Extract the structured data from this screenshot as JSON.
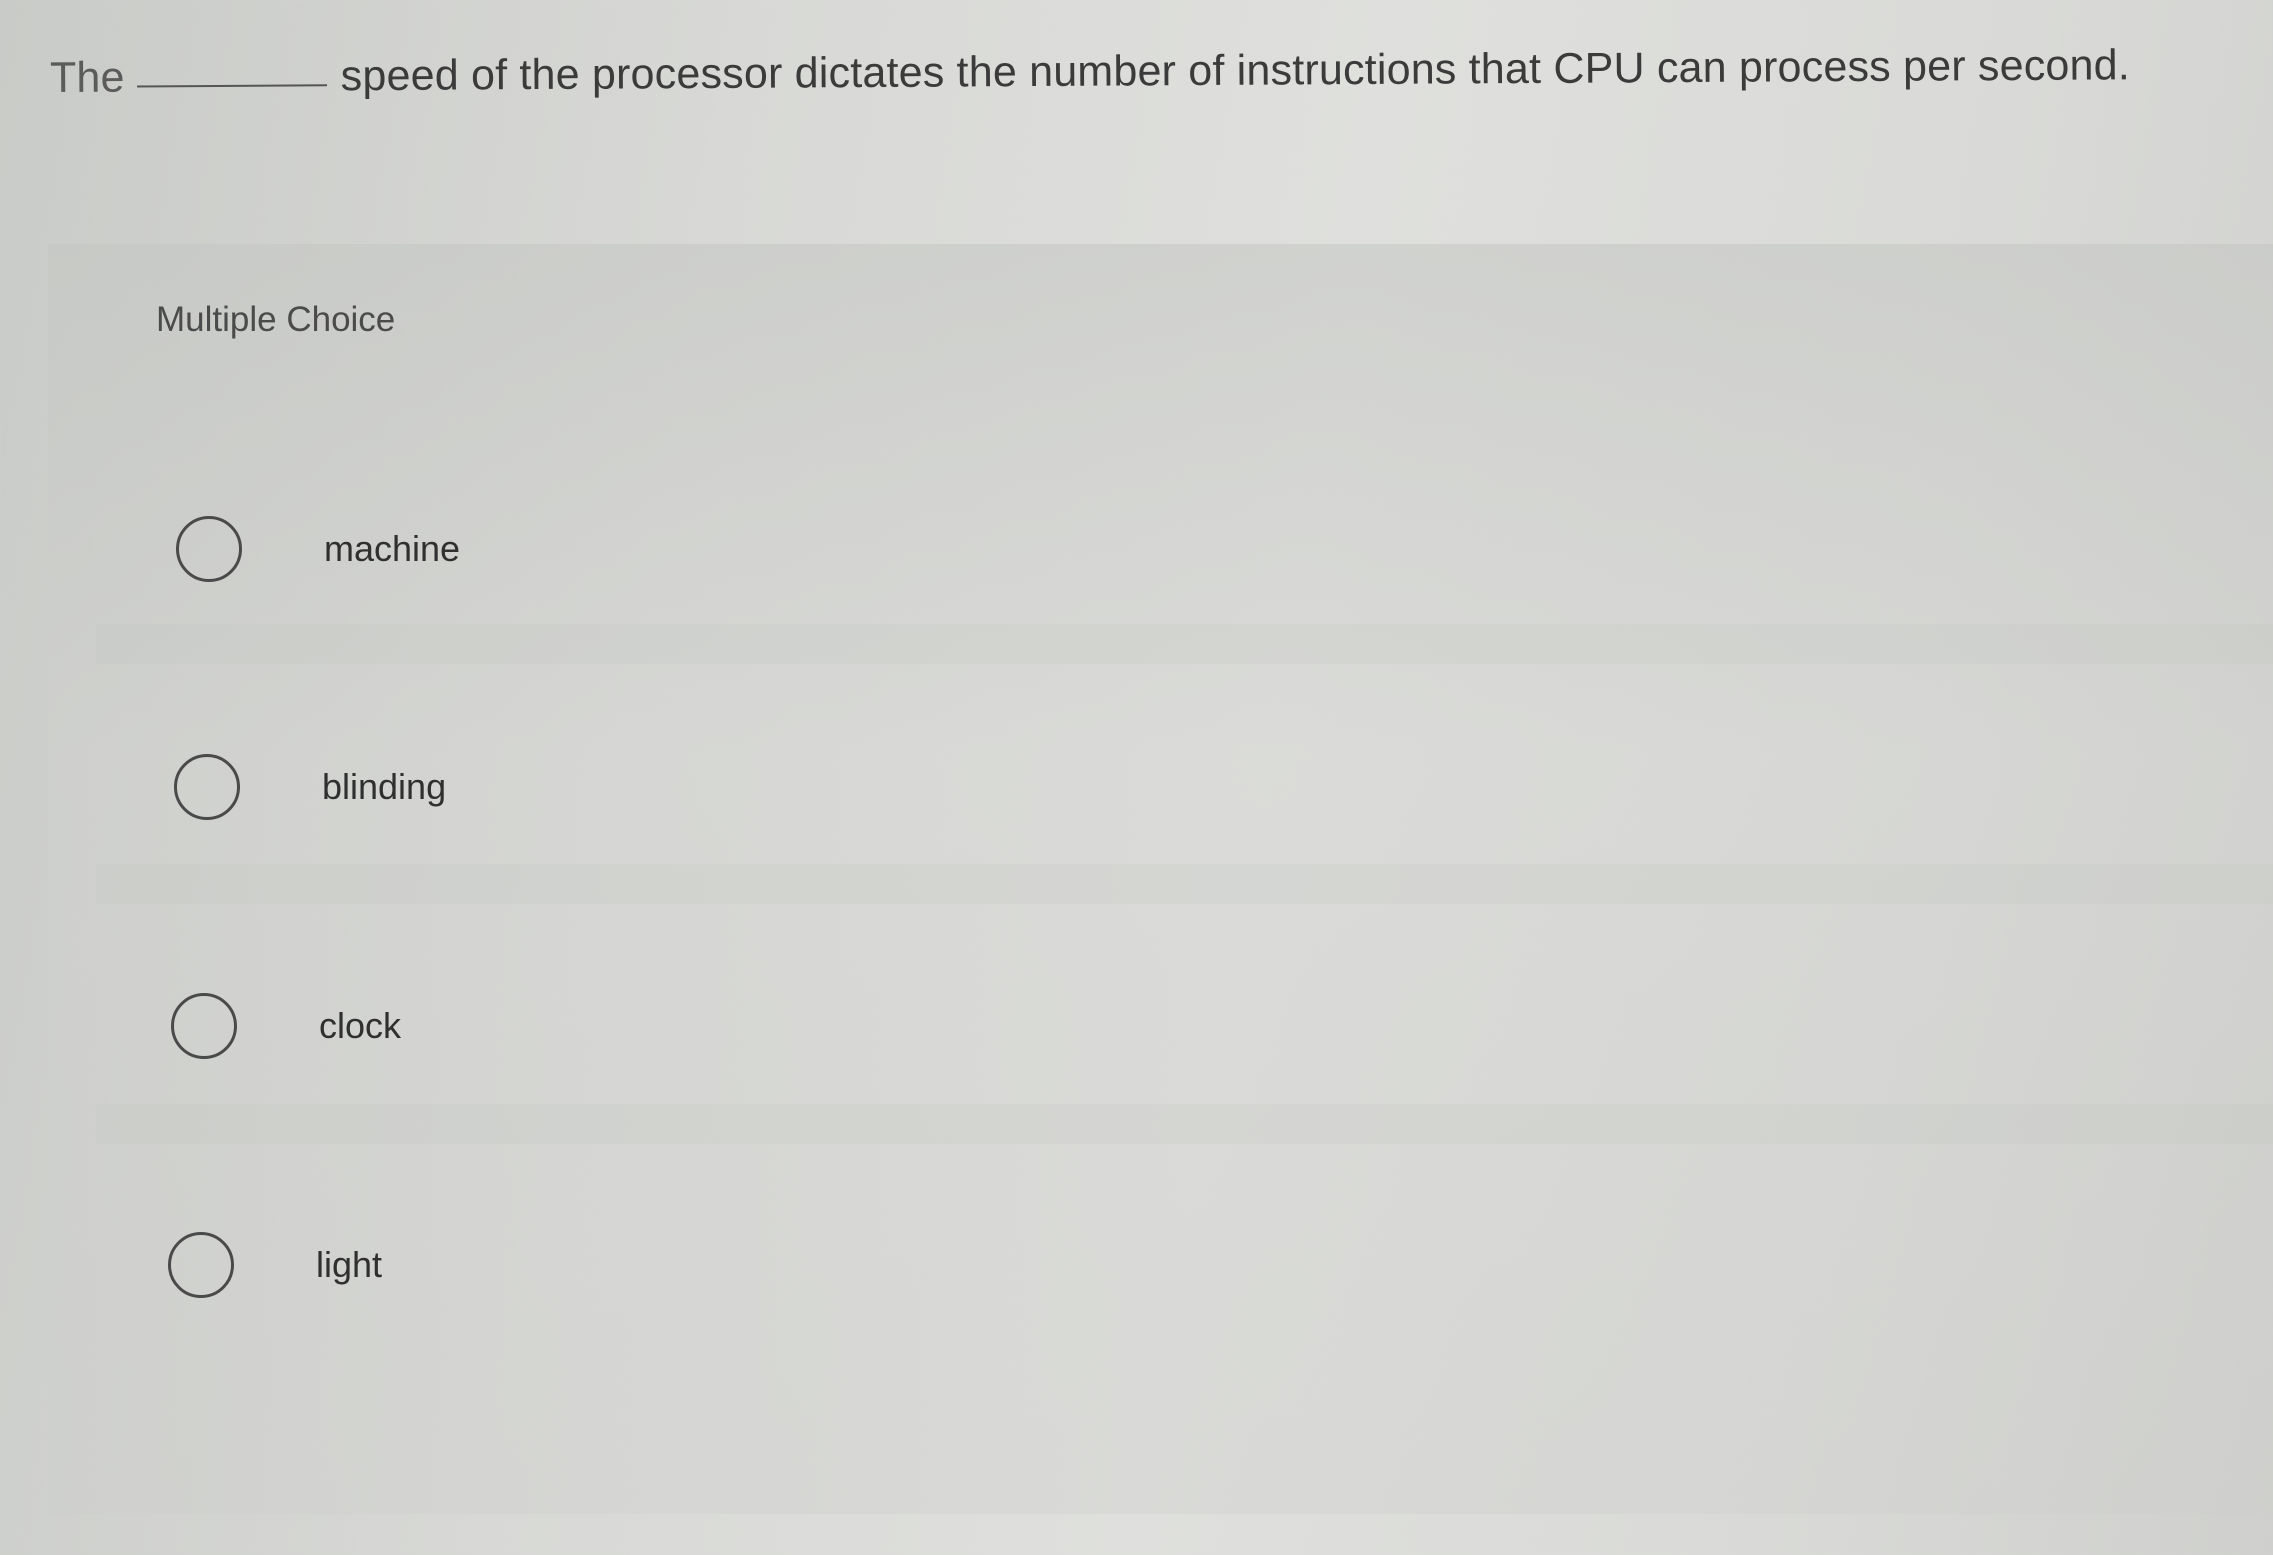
{
  "question": {
    "prefix": "The",
    "suffix": "speed of the processor dictates the number of instructions that CPU can process per second."
  },
  "panel": {
    "header": "Multiple Choice"
  },
  "options": [
    {
      "label": "machine",
      "selected": false
    },
    {
      "label": "blinding",
      "selected": false
    },
    {
      "label": "clock",
      "selected": false
    },
    {
      "label": "light",
      "selected": false
    }
  ]
}
